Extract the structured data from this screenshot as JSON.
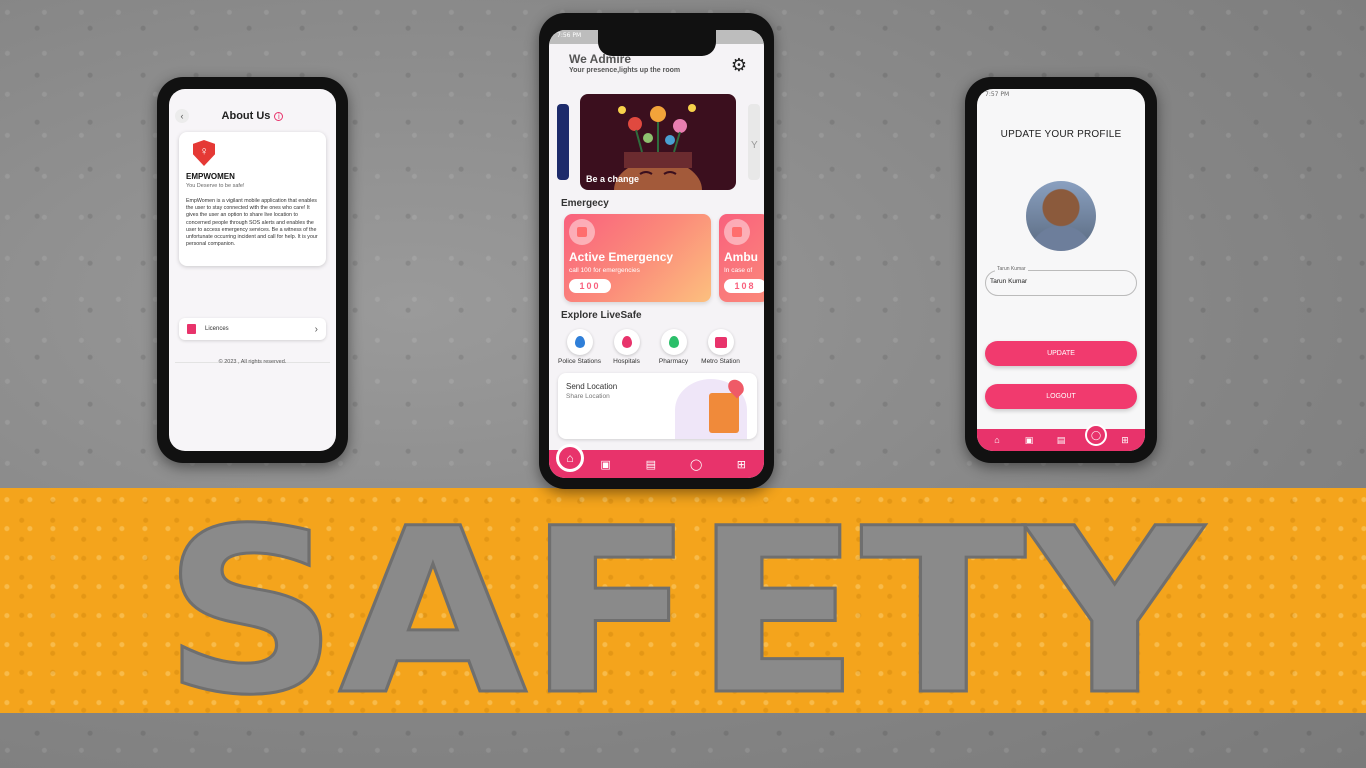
{
  "about_screen": {
    "title": "About Us",
    "app_name": "EMPWOMEN",
    "tagline": "You Deserve to be safe!",
    "description": "EmpWomen is a vigilant mobile application that enables the user to stay connected with the ones who care! It gives the user an option to share live location to concerned people through SOS alerts and enables the user to access emergency services. Be a witness of the unfortunate occurring incident and call for help. It is your personal companion.",
    "licences_label": "Licences",
    "copyright": "© 2023 , All rights reserved.",
    "accent": "#e8336b"
  },
  "home_screen": {
    "status_time": "7:56 PM",
    "greeting_title": "We Admire",
    "greeting_subtitle": "Your presence,lights up the room",
    "carousel_caption": "Be a change",
    "carousel_next_peek": "Y",
    "emergency_heading": "Emergecy",
    "emergency_cards": [
      {
        "title": "Active Emergency",
        "subtitle": "call 100 for emergencies",
        "number": "100"
      },
      {
        "title": "Ambu",
        "subtitle": "In case of",
        "number": "108"
      }
    ],
    "explore_heading": "Explore LiveSafe",
    "explore_items": [
      {
        "label": "Police Stations",
        "icon": "police-pin-icon",
        "color": "#2f7fd8"
      },
      {
        "label": "Hospitals",
        "icon": "hospital-pin-icon",
        "color": "#e8336b"
      },
      {
        "label": "Pharmacy",
        "icon": "pharmacy-pin-icon",
        "color": "#2bbf6a"
      },
      {
        "label": "Metro Station",
        "icon": "metro-icon",
        "color": "#e8336b"
      }
    ],
    "send_location_title": "Send Location",
    "send_location_subtitle": "Share Location",
    "nav_color": "#e8336b"
  },
  "profile_screen": {
    "status_time": "7:57 PM",
    "title": "UPDATE YOUR PROFILE",
    "name_label": "Tarun Kumar",
    "name_value": "Tarun Kumar",
    "update_label": "UPDATE",
    "logout_label": "LOGOUT",
    "button_color": "#f13a6e"
  },
  "banner": {
    "word": "SAFETY",
    "band_color": "#f4a41c"
  }
}
